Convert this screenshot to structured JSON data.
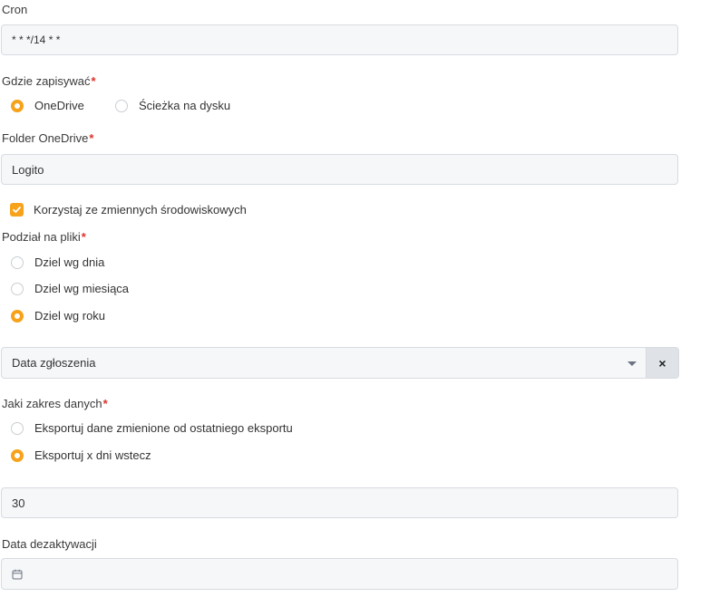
{
  "cron": {
    "label": "Cron",
    "value": "* * */14 * *"
  },
  "save_location": {
    "label": "Gdzie zapisywać",
    "options": [
      "OneDrive",
      "Ścieżka na dysku"
    ],
    "selected": "OneDrive"
  },
  "onedrive_folder": {
    "label": "Folder OneDrive",
    "value": "Logito"
  },
  "env_vars": {
    "label": "Korzystaj ze zmiennych środowiskowych",
    "checked": true
  },
  "split": {
    "label": "Podział na pliki",
    "options": [
      "Dziel wg dnia",
      "Dziel wg miesiąca",
      "Dziel wg roku"
    ],
    "selected": "Dziel wg roku"
  },
  "date_field": {
    "value": "Data zgłoszenia",
    "clear": "×"
  },
  "range": {
    "label": "Jaki zakres danych",
    "options": [
      "Eksportuj dane zmienione od ostatniego eksportu",
      "Eksportuj x dni wstecz"
    ],
    "selected": "Eksportuj x dni wstecz"
  },
  "days": {
    "value": "30"
  },
  "deactivation": {
    "label": "Data dezaktywacji",
    "value": ""
  },
  "icons": {
    "calendar": "calendar-icon",
    "chevron": "chevron-down-icon",
    "check": "check-icon"
  },
  "colors": {
    "accent": "#f7a21b",
    "required": "#e0322b"
  }
}
